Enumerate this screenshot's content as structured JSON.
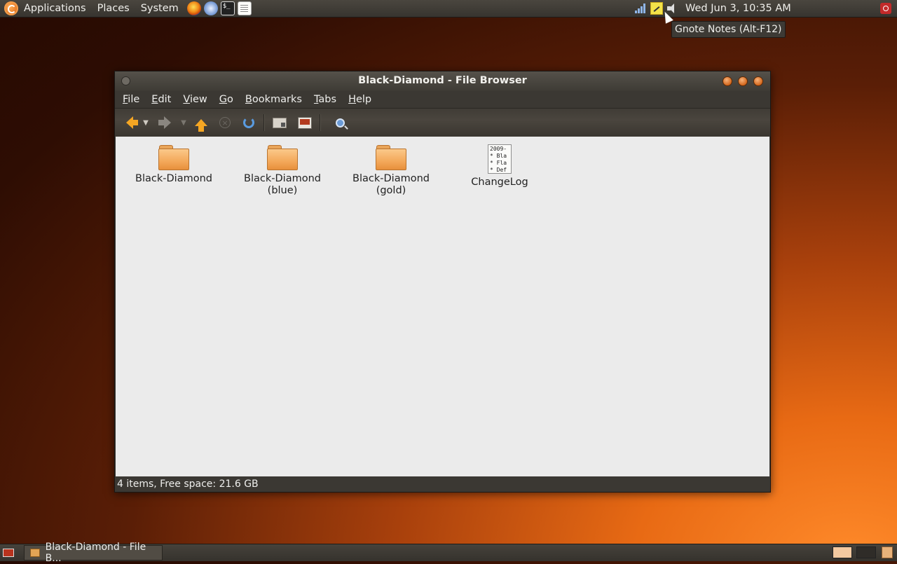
{
  "top_panel": {
    "menus": [
      "Applications",
      "Places",
      "System"
    ],
    "launchers": [
      "firefox-icon",
      "mail-icon",
      "terminal-icon",
      "text-editor-icon"
    ],
    "clock": "Wed Jun  3, 10:35 AM",
    "tooltip": "Gnote Notes (Alt-F12)"
  },
  "window": {
    "title": "Black-Diamond - File Browser",
    "menubar": [
      {
        "label": "File",
        "key": "F",
        "rest": "ile"
      },
      {
        "label": "Edit",
        "key": "E",
        "rest": "dit"
      },
      {
        "label": "View",
        "key": "V",
        "rest": "iew"
      },
      {
        "label": "Go",
        "key": "G",
        "rest": "o"
      },
      {
        "label": "Bookmarks",
        "key": "B",
        "rest": "ookmarks"
      },
      {
        "label": "Tabs",
        "key": "T",
        "rest": "abs"
      },
      {
        "label": "Help",
        "key": "H",
        "rest": "elp"
      }
    ],
    "toolbar_icons": [
      "back-arrow-icon",
      "forward-arrow-icon",
      "up-arrow-icon",
      "stop-icon",
      "reload-icon",
      "home-folder-icon",
      "computer-icon",
      "search-icon"
    ],
    "items": [
      {
        "type": "folder",
        "label": "Black-Diamond"
      },
      {
        "type": "folder",
        "label": "Black-Diamond\n(blue)"
      },
      {
        "type": "folder",
        "label": "Black-Diamond\n(gold)"
      },
      {
        "type": "file",
        "label": "ChangeLog",
        "preview": "2009-\n* Bla\n* Fla\n* Def"
      }
    ],
    "status": "4 items, Free space: 21.6 GB"
  },
  "bottom_panel": {
    "task_label": "Black-Diamond - File B..."
  },
  "colors": {
    "accent": "#f5a623",
    "panel": "#3b3833",
    "content_bg": "#ebebeb"
  }
}
